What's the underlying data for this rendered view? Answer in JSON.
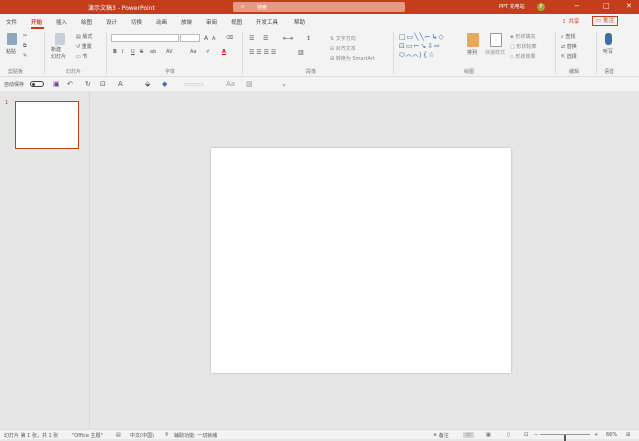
{
  "app": {
    "title": "演示文稿3 - PowerPoint",
    "search_label": "搜索",
    "user_name": "PPT 充电站",
    "avatar_initial": "P"
  },
  "window_controls": [
    "−",
    "□",
    "✕"
  ],
  "tabs": [
    {
      "label": "文件"
    },
    {
      "label": "开始",
      "active": true
    },
    {
      "label": "插入"
    },
    {
      "label": "绘图"
    },
    {
      "label": "设计"
    },
    {
      "label": "切换"
    },
    {
      "label": "动画"
    },
    {
      "label": "放映"
    },
    {
      "label": "审阅"
    },
    {
      "label": "视图"
    },
    {
      "label": "开发工具"
    },
    {
      "label": "帮助"
    }
  ],
  "share_label": "共享",
  "comment_label": "批注",
  "ribbon": {
    "clipboard": {
      "paste": "粘贴",
      "label": "剪贴板"
    },
    "slides": {
      "new_slide": "新建\n幻灯片",
      "layout": "版式",
      "reset": "重置",
      "section": "节",
      "label": "幻灯片"
    },
    "font": {
      "label": "字体",
      "bold": "B",
      "italic": "I",
      "underline": "U",
      "strike": "S",
      "shadow": "ab",
      "spacing": "AV",
      "case": "Aa",
      "font_color": "A",
      "grow": "A",
      "shrink": "A"
    },
    "paragraph": {
      "text_direction": "文字方向",
      "align_text": "对齐文本",
      "smartart": "转换为 SmartArt",
      "label": "段落"
    },
    "drawing": {
      "shapes_glyphs": "□▭╲╲⌐↳◇ ⊡▭⌐↘⇩⇨ ⬭⌒⌒⟩{☆",
      "arrange": "排列",
      "quick_styles": "快速样式",
      "fill": "形状填充",
      "outline": "形状轮廓",
      "effects": "形状效果",
      "label": "绘图"
    },
    "editing": {
      "find": "查找",
      "replace": "替换",
      "select": "选择",
      "label": "编辑"
    },
    "voice": {
      "dictate": "听写",
      "label": "语音"
    }
  },
  "qat": {
    "autosave": "自动保存"
  },
  "thumbs": [
    {
      "number": "1"
    }
  ],
  "status": {
    "slide_info": "幻灯片 第 1 张，共 1 张",
    "theme": "\"Office 主题\"",
    "language": "中文(中国)",
    "accessibility": "辅助功能: 一切就绪",
    "notes": "备注",
    "zoom": "66%",
    "zoom_level": 0.66
  },
  "colors": {
    "accent": "#c43e1c",
    "background": "#e6e6e6"
  }
}
